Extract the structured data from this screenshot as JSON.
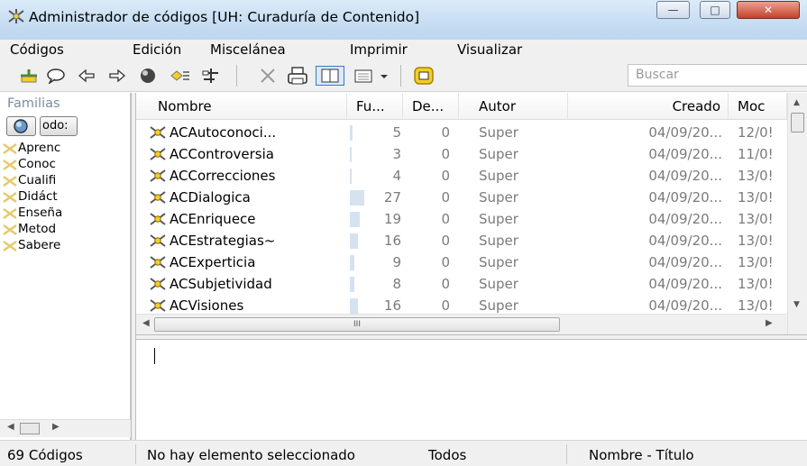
{
  "window": {
    "title": "Administrador de códigos [UH: Curaduría de Contenido]",
    "minimize_glyph": "—",
    "maximize_glyph": "□",
    "close_glyph": "✕"
  },
  "menu": [
    "Códigos",
    "Edición",
    "Miscelánea",
    "Imprimir",
    "Visualizar"
  ],
  "toolbar": {
    "search_placeholder": "Buscar",
    "icons": [
      "new-code-icon",
      "comment-icon",
      "arrow-left-icon",
      "arrow-right-icon",
      "color-icon",
      "link-codes-icon",
      "network-icon",
      "delete-icon",
      "print-icon",
      "split-view-icon",
      "view-options-icon",
      "filter-icon"
    ]
  },
  "families": {
    "header": "Familias",
    "all_button_label": "odo:",
    "items": [
      "Aprenc",
      "Conoc",
      "Cualifi",
      "Didáct",
      "Enseña",
      "Metod",
      "Sabere"
    ]
  },
  "list": {
    "columns": [
      "Nombre",
      "Fu...",
      "De...",
      "Autor",
      "Creado",
      "Moc"
    ],
    "rows": [
      {
        "name": "ACAutoconoci...",
        "fu": "5",
        "de": "0",
        "author": "Super",
        "created": "04/09/20...",
        "modified": "12/0!",
        "bar_fraction": 0.19
      },
      {
        "name": "ACControversia",
        "fu": "3",
        "de": "0",
        "author": "Super",
        "created": "04/09/20...",
        "modified": "11/0!",
        "bar_fraction": 0.11
      },
      {
        "name": "ACCorrecciones",
        "fu": "4",
        "de": "0",
        "author": "Super",
        "created": "04/09/20...",
        "modified": "13/0!",
        "bar_fraction": 0.15
      },
      {
        "name": "ACDialogica",
        "fu": "27",
        "de": "0",
        "author": "Super",
        "created": "04/09/20...",
        "modified": "13/0!",
        "bar_fraction": 1.0
      },
      {
        "name": "ACEnriquece",
        "fu": "19",
        "de": "0",
        "author": "Super",
        "created": "04/09/20...",
        "modified": "13/0!",
        "bar_fraction": 0.7
      },
      {
        "name": "ACEstrategias~",
        "fu": "16",
        "de": "0",
        "author": "Super",
        "created": "04/09/20...",
        "modified": "13/0!",
        "bar_fraction": 0.59
      },
      {
        "name": "ACExperticia",
        "fu": "9",
        "de": "0",
        "author": "Super",
        "created": "04/09/20...",
        "modified": "13/0!",
        "bar_fraction": 0.33
      },
      {
        "name": "ACSubjetividad",
        "fu": "8",
        "de": "0",
        "author": "Super",
        "created": "04/09/20...",
        "modified": "13/0!",
        "bar_fraction": 0.3
      },
      {
        "name": "ACVisiones",
        "fu": "16",
        "de": "0",
        "author": "Super",
        "created": "04/09/20...",
        "modified": "13/0!",
        "bar_fraction": 0.59
      }
    ],
    "hscroll_thumb_glyph": "III"
  },
  "status": {
    "count": "69 Códigos",
    "selection": "No hay elemento seleccionado",
    "filter": "Todos",
    "sort": "Nombre - Título"
  },
  "colors": {
    "code_icon": "#f4cd2a",
    "family_icon": "#f2d98a",
    "accent": "#3399ff"
  }
}
